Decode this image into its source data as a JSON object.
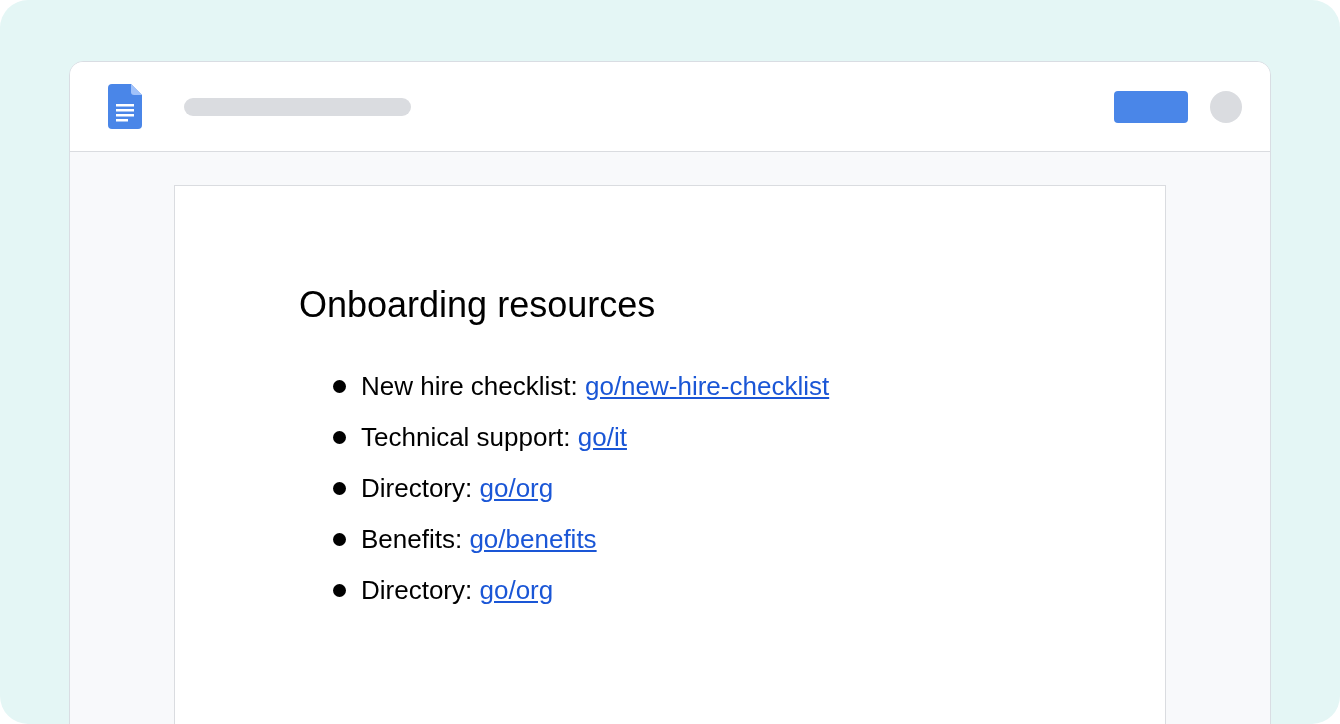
{
  "document": {
    "heading": "Onboarding resources",
    "items": [
      {
        "label": "New hire checklist:",
        "link": "go/new-hire-checklist"
      },
      {
        "label": "Technical support:",
        "link": "go/it"
      },
      {
        "label": "Directory:",
        "link": "go/org"
      },
      {
        "label": "Benefits:",
        "link": "go/benefits"
      },
      {
        "label": "Directory:",
        "link": "go/org"
      }
    ]
  }
}
